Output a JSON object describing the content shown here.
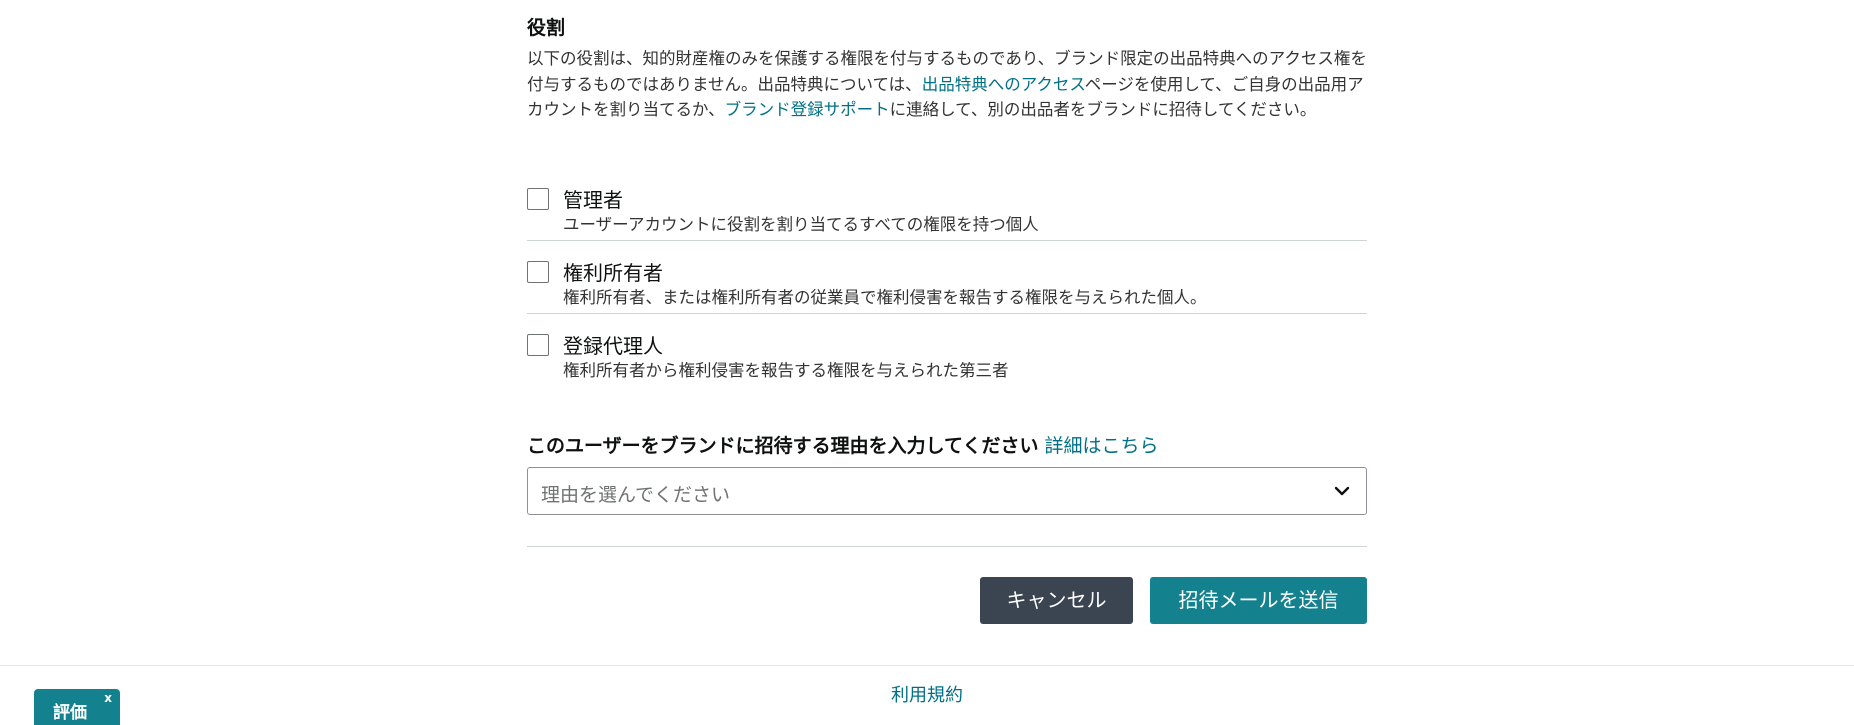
{
  "roles_section": {
    "title": "役割",
    "description_part1": "以下の役割は、知的財産権のみを保護する権限を付与するものであり、ブランド限定の出品特典へのアクセス権を付与するものではありません。出品特典については、",
    "link_seller_benefits": "出品特典へのアクセス",
    "description_part2": "ページを使用して、ご自身の出品用アカウントを割り当てるか、",
    "link_brand_support": "ブランド登録サポート",
    "description_part3": "に連絡して、別の出品者をブランドに招待してください。",
    "roles": [
      {
        "name": "管理者",
        "description": "ユーザーアカウントに役割を割り当てるすべての権限を持つ個人"
      },
      {
        "name": "権利所有者",
        "description": "権利所有者、または権利所有者の従業員で権利侵害を報告する権限を与えられた個人。"
      },
      {
        "name": "登録代理人",
        "description": "権利所有者から権利侵害を報告する権限を与えられた第三者"
      }
    ]
  },
  "reason_section": {
    "label": "このユーザーをブランドに招待する理由を入力してください",
    "learn_more_link": "詳細はこちら",
    "select_placeholder": "理由を選んでください"
  },
  "actions": {
    "cancel_label": "キャンセル",
    "send_label": "招待メールを送信"
  },
  "footer": {
    "terms_link": "利用規約"
  },
  "feedback_tab": {
    "label": "評価",
    "close_label": "x"
  },
  "colors": {
    "link": "#007185",
    "primary_button": "#14818f",
    "secondary_button": "#3b4451"
  }
}
